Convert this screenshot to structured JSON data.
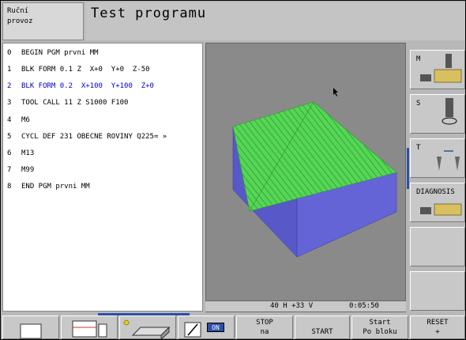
{
  "header": {
    "mode_line1": "Ruční",
    "mode_line2": "provoz",
    "title": "Test programu"
  },
  "program": [
    {
      "num": "0",
      "text": "BEGIN PGM prvni MM",
      "active": false
    },
    {
      "num": "1",
      "text": "BLK FORM 0.1 Z  X+0  Y+0  Z-50",
      "active": false
    },
    {
      "num": "2",
      "text": "BLK FORM 0.2  X+100  Y+100  Z+0",
      "active": true
    },
    {
      "num": "3",
      "text": "TOOL CALL 11 Z S1000 F100",
      "active": false
    },
    {
      "num": "4",
      "text": "M6",
      "active": false
    },
    {
      "num": "5",
      "text": "CYCL DEF 231 OBECNE ROVINY Q225= »",
      "active": false
    },
    {
      "num": "6",
      "text": "M13",
      "active": false
    },
    {
      "num": "7",
      "text": "M99",
      "active": false
    },
    {
      "num": "8",
      "text": "END PGM prvni MM",
      "active": false
    }
  ],
  "status": {
    "position": "40 H +33 V",
    "time": "0:05:50"
  },
  "right_softkeys": [
    {
      "label": "M",
      "icon": "spindle-table-icon"
    },
    {
      "label": "S",
      "icon": "spindle-rotation-icon"
    },
    {
      "label": "T",
      "icon": "tool-change-icon"
    },
    {
      "label": "DIAGNOSIS",
      "icon": "machine-table-icon"
    },
    {
      "label": "",
      "icon": ""
    },
    {
      "label": "",
      "icon": ""
    }
  ],
  "bottom_softkeys": [
    {
      "line1": "",
      "line2": ""
    },
    {
      "line1": "",
      "line2": ""
    },
    {
      "line1": "",
      "line2": ""
    },
    {
      "line1": "",
      "line2": "",
      "badge": "ON"
    },
    {
      "line1": "STOP",
      "line2": "na"
    },
    {
      "line1": "",
      "line2": "START"
    },
    {
      "line1": "Start",
      "line2": "Po bloku"
    },
    {
      "line1": "RESET",
      "line2": "+"
    }
  ],
  "colors": {
    "active_line": "#0000cc",
    "block_blue": "#5a5ad0",
    "surface_green": "#4fd14f",
    "accent_bar": "#2d4fa8"
  }
}
